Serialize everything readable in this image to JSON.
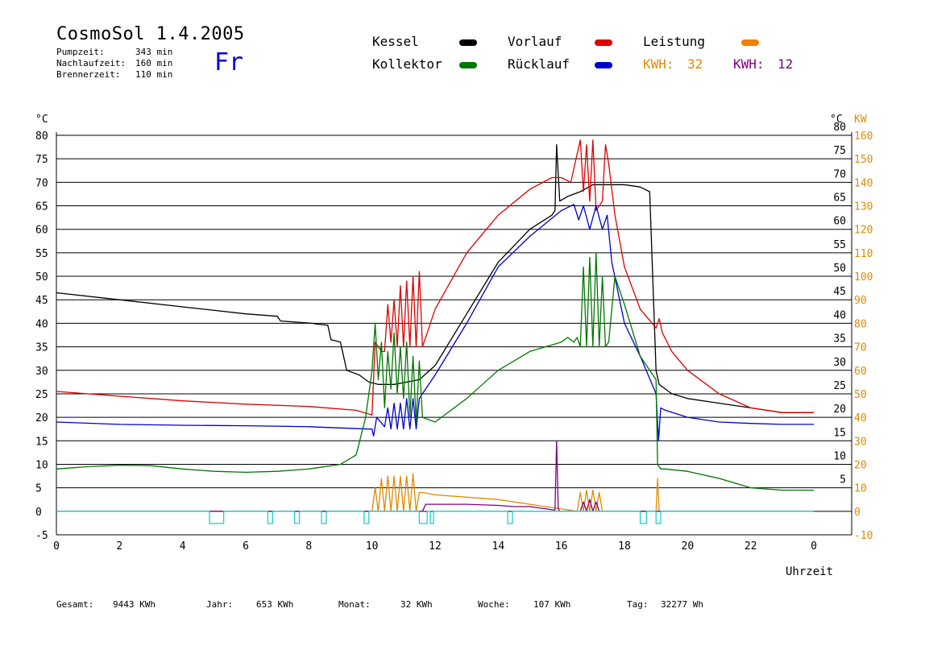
{
  "header": {
    "title": "CosmoSol 1.4.2005",
    "day": "Fr",
    "stats": [
      {
        "label": "Pumpzeit:",
        "value": "343 min"
      },
      {
        "label": "Nachlaufzeit:",
        "value": "160 min"
      },
      {
        "label": "Brennerzeit:",
        "value": "110 min"
      }
    ]
  },
  "legend": {
    "items": [
      {
        "label": "Kessel",
        "color": "#000000"
      },
      {
        "label": "Vorlauf",
        "color": "#dd0000"
      },
      {
        "label": "Leistung",
        "color": "#f08000"
      },
      {
        "label": "Kollektor",
        "color": "#007700"
      },
      {
        "label": "Rücklauf",
        "color": "#0000cc"
      }
    ],
    "kwh": [
      {
        "label": "KWH:",
        "value": "32",
        "color": "#e08a00"
      },
      {
        "label": "KWH:",
        "value": "12",
        "color": "#800080"
      }
    ]
  },
  "footer": [
    {
      "label": "Gesamt:",
      "value": "9443 KWh"
    },
    {
      "label": "Jahr:",
      "value": "653 KWh"
    },
    {
      "label": "Monat:",
      "value": "32 KWh"
    },
    {
      "label": "Woche:",
      "value": "107 KWh"
    },
    {
      "label": "Tag:",
      "value": "32277 Wh"
    }
  ],
  "chart_data": {
    "type": "line",
    "xlabel": "Uhrzeit",
    "ylabel_left": "°C",
    "ylabel_right_unit1": "°C",
    "ylabel_right_unit2": "KW",
    "xlim": [
      0,
      24
    ],
    "ylim": [
      -5,
      80
    ],
    "ylim_kw": [
      -10,
      160
    ],
    "grid": true,
    "x_ticks": [
      "0",
      "2",
      "4",
      "6",
      "8",
      "10",
      "12",
      "14",
      "16",
      "18",
      "20",
      "22",
      "0"
    ],
    "y_ticks": [
      "80",
      "75",
      "70",
      "65",
      "60",
      "55",
      "50",
      "45",
      "40",
      "35",
      "30",
      "25",
      "20",
      "15",
      "10",
      "5",
      "0",
      "-5"
    ],
    "y_ticks_right": [
      "80",
      "75",
      "70",
      "65",
      "60",
      "55",
      "50",
      "45",
      "40",
      "35",
      "30",
      "25",
      "20",
      "15",
      "10",
      "5"
    ],
    "kw_ticks": [
      "160",
      "150",
      "140",
      "130",
      "120",
      "110",
      "100",
      "90",
      "80",
      "70",
      "60",
      "50",
      "40",
      "30",
      "20",
      "10",
      "0",
      "-10"
    ],
    "series": [
      {
        "name": "Kessel",
        "color": "#000000",
        "x": [
          0,
          2,
          4,
          6,
          7,
          7.1,
          8.1,
          8.3,
          8.6,
          8.7,
          9,
          9.2,
          9.6,
          9.9,
          10.2,
          10.7,
          11.5,
          12,
          13,
          14,
          15,
          15.7,
          15.8,
          15.85,
          15.95,
          16.2,
          16.6,
          17,
          17.5,
          18,
          18.5,
          18.8,
          19,
          19.1,
          19.3,
          19.5,
          20,
          21,
          21.5,
          22,
          22.5,
          23,
          24
        ],
        "y": [
          46.5,
          45,
          43.5,
          42,
          41.5,
          40.5,
          40,
          39.8,
          39.6,
          36.5,
          36,
          30,
          29,
          27.5,
          27,
          27,
          28,
          31,
          42,
          53,
          60,
          63,
          64,
          78,
          66,
          67,
          68,
          69.5,
          69.5,
          69.5,
          69,
          68,
          30,
          27,
          26,
          25,
          24,
          23,
          22.5,
          22,
          21.5,
          21,
          21
        ]
      },
      {
        "name": "Vorlauf",
        "color": "#dd0000",
        "x": [
          0,
          2,
          4,
          6,
          8,
          9.5,
          10,
          10.1,
          10.2,
          10.3,
          10.4,
          10.5,
          10.6,
          10.7,
          10.8,
          10.9,
          11,
          11.1,
          11.2,
          11.3,
          11.4,
          11.5,
          11.6,
          11.7,
          12,
          13,
          14,
          15,
          15.7,
          16,
          16.3,
          16.6,
          16.7,
          16.8,
          16.9,
          17,
          17.1,
          17.3,
          17.4,
          17.5,
          17.7,
          18,
          18.5,
          19,
          19.1,
          19.2,
          19.5,
          20,
          21,
          22,
          23,
          24
        ],
        "y": [
          25.5,
          24.5,
          23.5,
          22.8,
          22.3,
          21.5,
          20.5,
          36,
          35,
          34,
          34,
          44,
          36,
          45,
          35,
          48,
          35,
          49,
          35,
          50,
          35,
          51,
          35,
          37,
          43,
          55,
          63,
          68.5,
          71,
          71,
          70,
          79,
          68,
          78,
          66,
          79,
          64,
          66,
          78,
          74,
          63,
          52,
          43,
          39,
          41,
          38,
          34,
          30,
          25,
          22,
          21,
          21
        ]
      },
      {
        "name": "Rücklauf",
        "color": "#0000cc",
        "x": [
          0,
          2,
          4,
          6,
          8,
          9.9,
          10,
          10.05,
          10.15,
          10.4,
          10.5,
          10.6,
          10.7,
          10.8,
          10.9,
          11,
          11.1,
          11.2,
          11.3,
          11.4,
          11.5,
          11.6,
          12,
          13,
          14,
          15,
          16,
          16.4,
          16.55,
          16.7,
          16.9,
          17.1,
          17.3,
          17.45,
          17.6,
          18,
          18.5,
          19,
          19.08,
          19.15,
          19.3,
          20,
          21,
          22,
          23,
          24
        ],
        "y": [
          19,
          18.5,
          18.3,
          18.2,
          18,
          17.5,
          17.5,
          16,
          20,
          18,
          22,
          17.5,
          23,
          17.5,
          23,
          17.5,
          24,
          17.5,
          24,
          17.5,
          24,
          25,
          29,
          40,
          52,
          58.5,
          64,
          65.3,
          62,
          65,
          60,
          65,
          60,
          63,
          53,
          40,
          33,
          25,
          15,
          22,
          21.5,
          20,
          19,
          18.7,
          18.5,
          18.5
        ]
      },
      {
        "name": "Kollektor",
        "color": "#007700",
        "x": [
          0,
          1,
          2,
          3,
          4,
          5,
          6,
          7,
          8,
          9,
          9.5,
          9.8,
          10,
          10.1,
          10.2,
          10.3,
          10.4,
          10.5,
          10.6,
          10.7,
          10.8,
          10.9,
          11,
          11.1,
          11.2,
          11.3,
          11.4,
          11.5,
          11.6,
          12,
          13,
          14,
          15,
          16,
          16.2,
          16.4,
          16.5,
          16.6,
          16.7,
          16.8,
          16.9,
          17,
          17.1,
          17.2,
          17.3,
          17.4,
          17.5,
          17.7,
          18,
          18.5,
          19,
          19.05,
          19.15,
          19.3,
          20,
          21,
          21.5,
          22,
          23,
          24
        ],
        "y": [
          9,
          9.5,
          9.8,
          9.7,
          9,
          8.5,
          8.3,
          8.5,
          9,
          10,
          12,
          20,
          30,
          40,
          28,
          36,
          22,
          34,
          26,
          38,
          25,
          35,
          24,
          36,
          20,
          33,
          19,
          32,
          20,
          19,
          24,
          30,
          34,
          36,
          37,
          36,
          37,
          35,
          52,
          35,
          54,
          35,
          55,
          35,
          50,
          35,
          36,
          50,
          44,
          33,
          28,
          10,
          9,
          9,
          8.5,
          7,
          6,
          5,
          4.5,
          4.5
        ]
      },
      {
        "name": "Leistung",
        "color": "#e08a00",
        "axis": "kw",
        "x": [
          0,
          10,
          10.1,
          10.2,
          10.3,
          10.4,
          10.5,
          10.6,
          10.7,
          10.8,
          10.9,
          11,
          11.1,
          11.2,
          11.3,
          11.4,
          11.5,
          11.6,
          12,
          13,
          14,
          15,
          16,
          16.5,
          16.6,
          16.7,
          16.8,
          16.9,
          17,
          17.1,
          17.2,
          17.3,
          17.4,
          19,
          19.05,
          19.1,
          19.15,
          24
        ],
        "y": [
          0,
          0,
          10,
          0,
          14,
          0,
          15,
          0,
          15,
          0,
          15,
          0,
          15,
          0,
          16,
          0,
          8,
          8,
          7,
          6,
          5,
          3,
          1,
          0,
          8,
          0,
          9,
          0,
          9,
          0,
          8,
          0,
          0,
          0,
          14,
          0,
          0,
          0
        ]
      },
      {
        "name": "KWH 12",
        "color": "#800080",
        "axis": "kw",
        "x": [
          0,
          11.6,
          11.7,
          12,
          13,
          14,
          14.5,
          15,
          15.8,
          15.85,
          15.9,
          15.95,
          16,
          16.6,
          16.7,
          16.8,
          16.9,
          17,
          17.1,
          17.2,
          24
        ],
        "y": [
          0,
          0,
          3,
          3,
          3,
          2.5,
          2,
          2,
          0.5,
          30,
          1,
          0,
          0,
          0,
          4,
          0,
          5,
          0,
          4,
          0,
          0
        ]
      },
      {
        "name": "Status",
        "color": "#22cccc",
        "x": [
          0,
          4.85,
          4.85,
          5.3,
          5.3,
          6.7,
          6.7,
          6.85,
          6.85,
          7.55,
          7.55,
          7.7,
          7.7,
          8.4,
          8.4,
          8.55,
          8.55,
          9.75,
          9.75,
          9.9,
          9.9,
          11.5,
          11.5,
          11.75,
          11.75,
          11.85,
          11.85,
          11.95,
          11.95,
          14.3,
          14.3,
          14.45,
          14.45,
          18.5,
          18.5,
          18.7,
          18.7,
          19,
          19,
          19.15,
          19.15,
          24
        ],
        "y": [
          0,
          0,
          -2.6,
          -2.6,
          0,
          0,
          -2.6,
          -2.6,
          0,
          0,
          -2.6,
          -2.6,
          0,
          0,
          -2.6,
          -2.6,
          0,
          0,
          -2.6,
          -2.6,
          0,
          0,
          -2.6,
          -2.6,
          0,
          0,
          -2.6,
          -2.6,
          0,
          0,
          -2.6,
          -2.6,
          0,
          0,
          -2.6,
          -2.6,
          0,
          0,
          -2.6,
          -2.6,
          0,
          0
        ]
      }
    ]
  }
}
